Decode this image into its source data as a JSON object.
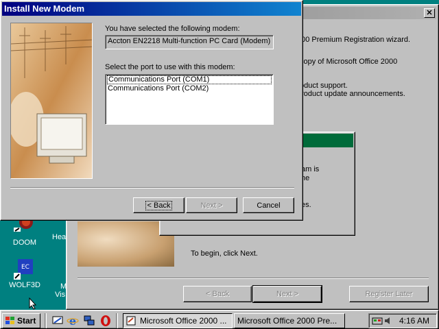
{
  "desktop": {
    "icons": [
      {
        "label": "DOOM",
        "icon": "doom-icon"
      },
      {
        "label": "Hea",
        "icon": "folder-icon"
      },
      {
        "label": "WOLF3D",
        "icon": "wolf3d-icon"
      },
      {
        "label": "M",
        "icon": "folder-icon"
      },
      {
        "label": "Vis",
        "icon": "folder-icon"
      }
    ]
  },
  "wizard_window": {
    "close_glyph": "✕",
    "lines": [
      "000 Premium Registration wizard.",
      "copy of Microsoft Office 2000",
      "oduct support.",
      "product update announcements."
    ],
    "panel_title": "egistration",
    "panel_lines": [
      "am is",
      "ne",
      "es."
    ],
    "begin_text": "To begin, click Next.",
    "buttons": {
      "back": "< Back",
      "next": "Next >",
      "register_later": "Register Later"
    }
  },
  "modem_dialog": {
    "title": "Install New Modem",
    "selected_label": "You have selected the following modem:",
    "modem_name": "Accton EN2218 Multi-function PC Card (Modem)",
    "port_label": "Select the port to use with this modem:",
    "ports": [
      "Communications Port (COM1)",
      "Communications Port (COM2)"
    ],
    "selected_port_index": 0,
    "buttons": {
      "back": "< Back",
      "next": "Next >",
      "cancel": "Cancel"
    }
  },
  "taskbar": {
    "start_label": "Start",
    "quick_launch": [
      "desktop-icon",
      "internet-explorer-icon",
      "network-icon",
      "opera-icon"
    ],
    "tasks": [
      "Microsoft Office 2000 ...",
      "Microsoft Office 2000 Pre..."
    ],
    "clock": "4:16 AM",
    "tray_icons": [
      "modem-tray-icon",
      "speaker-icon"
    ]
  },
  "colors": {
    "desktop": "#008080",
    "active_title": "#000080",
    "inactive_title": "#808080",
    "registration_header": "#006b3a"
  }
}
